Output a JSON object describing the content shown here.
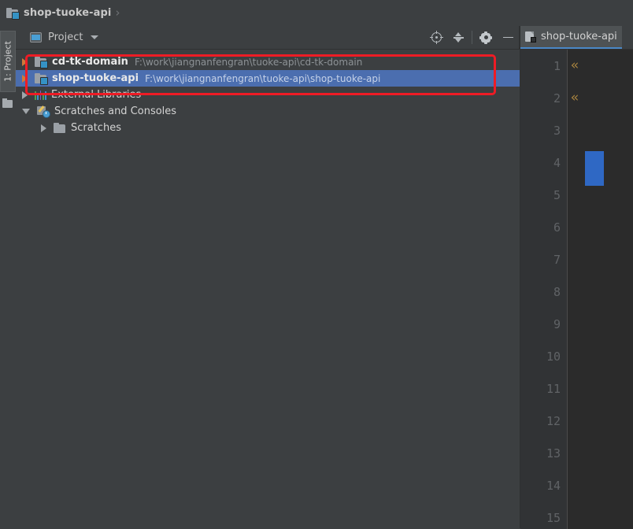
{
  "titlebar": {
    "project_name": "shop-tuoke-api",
    "separator": "›",
    "icon": "module-folder-icon"
  },
  "left_tool_strip": {
    "project_tab_label": "1: Project",
    "structure_icon": "structure-folder-icon"
  },
  "project_panel": {
    "header": {
      "view_icon": "project-view-icon",
      "title": "Project",
      "dropdown_icon": "chevron-down-icon",
      "toolbar_buttons": [
        {
          "name": "scroll-from-source-button",
          "icon": "target-icon",
          "tooltip": "Select Opened File"
        },
        {
          "name": "collapse-all-button",
          "icon": "collapse-all-icon",
          "tooltip": "Collapse All"
        },
        {
          "name": "settings-button",
          "icon": "gear-icon",
          "tooltip": "Settings"
        },
        {
          "name": "hide-button",
          "icon": "minus-icon",
          "tooltip": "Hide"
        }
      ]
    },
    "tree": [
      {
        "label": "cd-tk-domain",
        "path": "F:\\work\\jiangnanfengran\\tuoke-api\\cd-tk-domain",
        "icon": "module-folder-icon",
        "twisty": "collapsed",
        "twisty_color": "orange",
        "indent": 0,
        "selected": false,
        "bold": true
      },
      {
        "label": "shop-tuoke-api",
        "path": "F:\\work\\jiangnanfengran\\tuoke-api\\shop-tuoke-api",
        "icon": "module-folder-icon",
        "twisty": "collapsed",
        "twisty_color": "orange",
        "indent": 0,
        "selected": true,
        "bold": true
      },
      {
        "label": "External Libraries",
        "path": "",
        "icon": "external-libraries-icon",
        "twisty": "collapsed",
        "twisty_color": "gray",
        "indent": 0,
        "selected": false,
        "bold": false
      },
      {
        "label": "Scratches and Consoles",
        "path": "",
        "icon": "scratches-consoles-icon",
        "twisty": "expanded",
        "twisty_color": "gray",
        "indent": 0,
        "selected": false,
        "bold": false
      },
      {
        "label": "Scratches",
        "path": "",
        "icon": "folder-icon",
        "twisty": "collapsed",
        "twisty_color": "gray",
        "indent": 1,
        "selected": false,
        "bold": false
      }
    ],
    "annotation": {
      "name": "red-highlight-rectangle",
      "color": "#ee1c25"
    }
  },
  "editor": {
    "tab": {
      "label": "shop-tuoke-api",
      "icon": "file-icon"
    },
    "line_numbers": [
      "1",
      "2",
      "3",
      "4",
      "5",
      "6",
      "7",
      "8",
      "9",
      "10",
      "11",
      "12",
      "13",
      "14",
      "15"
    ],
    "fold_markers": [
      {
        "line": 1,
        "glyph": "«"
      },
      {
        "line": 2,
        "glyph": "«"
      }
    ],
    "selection_marker": {
      "line": 4,
      "color": "#2f68c4"
    }
  },
  "colors": {
    "panel_bg": "#3c3f41",
    "editor_bg": "#2b2b2b",
    "gutter_bg": "#313335",
    "selection_blue": "#4b6eaf",
    "accent_red": "#ee1c25",
    "tab_underline": "#4a88c7"
  }
}
